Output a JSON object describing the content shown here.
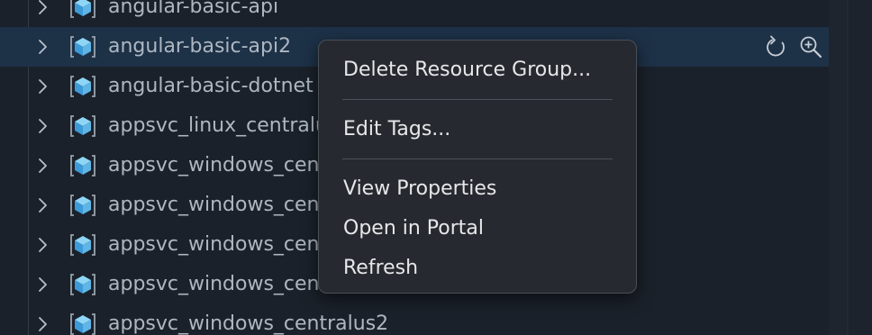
{
  "tree": {
    "rows": [
      {
        "label": "angular-basic-api",
        "selected": false
      },
      {
        "label": "angular-basic-api2",
        "selected": true
      },
      {
        "label": "angular-basic-dotnet",
        "selected": false
      },
      {
        "label": "appsvc_linux_centralus",
        "selected": false
      },
      {
        "label": "appsvc_windows_centralus",
        "selected": false
      },
      {
        "label": "appsvc_windows_centralus",
        "selected": false
      },
      {
        "label": "appsvc_windows_centralus",
        "selected": false
      },
      {
        "label": "appsvc_windows_centralus",
        "selected": false
      },
      {
        "label": "appsvc_windows_centralus2",
        "selected": false
      }
    ],
    "row_actions": [
      "refresh-icon",
      "zoom-in-icon"
    ]
  },
  "context_menu": {
    "delete_label": "Delete Resource Group...",
    "edit_tags_label": "Edit Tags...",
    "view_properties_label": "View Properties",
    "open_in_portal_label": "Open in Portal",
    "refresh_label": "Refresh"
  },
  "colors": {
    "background": "#1b212a",
    "selected_row": "#1d3147",
    "menu_background": "#26292f",
    "icon_blue": "#5fb6e6"
  }
}
